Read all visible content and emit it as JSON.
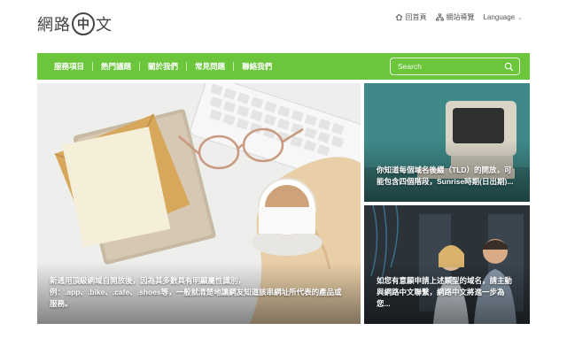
{
  "logo": {
    "part_a": "網路",
    "mark": "中",
    "part_b": "文"
  },
  "top_links": [
    {
      "label": "回首頁",
      "icon": "home-icon"
    },
    {
      "label": "網站導覽",
      "icon": "sitemap-icon"
    },
    {
      "label": "Language",
      "icon": "chevron-down-icon"
    }
  ],
  "nav": {
    "items": [
      "服務項目",
      "熱門議題",
      "關於我們",
      "常見問題",
      "聯絡我們"
    ],
    "accent_color": "#6bc63b"
  },
  "search": {
    "placeholder": "Search"
  },
  "cards": [
    {
      "caption": "新通用頂級網域自開放後，因為其多數具有明顯屬性識別，例：.app、.bike、.cafe、.shoes等，一般就清楚地讓網友知道該串網址所代表的產品或服務。"
    },
    {
      "caption": "你知道每個域名後綴（TLD）的開放，可能包含四個階段，Sunrise時期(日出期)..."
    },
    {
      "caption": "如您有意願申請上述類型的域名，請主動與網路中文聯繫，網路中文將進一步為您..."
    }
  ]
}
